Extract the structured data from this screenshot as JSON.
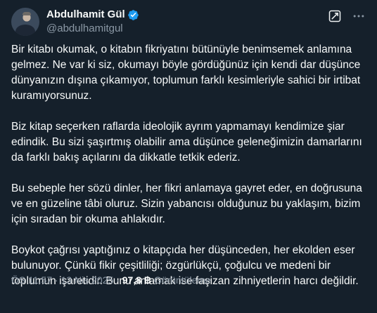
{
  "author": {
    "display_name": "Abdulhamit Gül",
    "handle": "@abdulhamitgul",
    "verified": true
  },
  "icons": {
    "verified": "verified-badge-icon",
    "grok": "grok-icon",
    "more": "more-options-icon"
  },
  "colors": {
    "background": "#15202b",
    "text": "#f7f9f9",
    "muted": "#8b98a5",
    "verified": "#1d9bf0"
  },
  "tweet": {
    "paragraphs": [
      "Bir kitabı okumak, o kitabın fikriyatını bütünüyle benimsemek anlamına gelmez. Ne var ki siz, okumayı böyle gördüğünüz için kendi dar düşünce dünyanızın dışına çıkamıyor, toplumun farklı kesimleriyle sahici bir irtibat kuramıyorsunuz.",
      "Biz kitap seçerken raflarda ideolojik ayrım yapmamayı kendimize şiar edindik. Bu sizi şaşırtmış olabilir ama düşünce geleneğimizin damarlarını da farklı bakış açılarını da dikkatle tetkik ederiz.",
      "Bu sebeple her sözü dinler, her fikri anlamaya gayret eder, en doğrusuna ve en güzeline tâbi oluruz. Sizin yabancısı olduğunuz bu yaklaşım, bizim için sıradan bir okuma ahlakıdır.",
      "Boykot çağrısı yaptığınız o kitapçıda her düşünceden, her ekolden eser bulunuyor. Çünkü fikir çeşitliliği; özgürlükçü, çoğulcu ve medeni bir toplumun işaretidir. Bunu anlamak ise faşizan zihniyetlerin harcı değildir."
    ]
  },
  "meta": {
    "time": "ÖS 11:57",
    "separator": "·",
    "date": "13 Nis 2025",
    "views_count": "97,8 B",
    "views_label": "Görüntüleme"
  }
}
